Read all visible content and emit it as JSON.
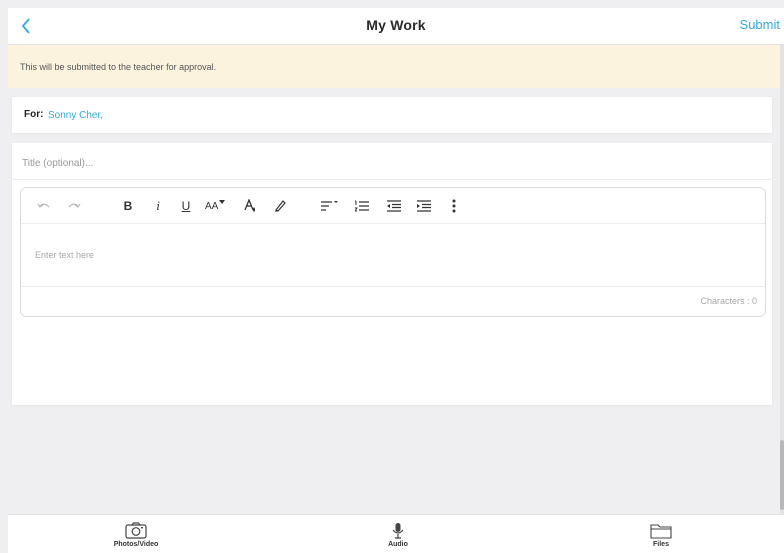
{
  "header": {
    "title": "My Work",
    "submit_label": "Submit",
    "accent_color": "#35a9dd"
  },
  "notice": {
    "text": "This will be submitted to the teacher for approval.",
    "background": "#fbf3de"
  },
  "recipient": {
    "label": "For:",
    "value": "Sonny Cher,"
  },
  "title_field": {
    "placeholder": "Title (optional)..."
  },
  "editor": {
    "placeholder": "Enter text here",
    "characters_label": "Characters : ",
    "characters_count": "0",
    "toolbar": {
      "undo_icon": "undo-icon",
      "redo_icon": "redo-icon",
      "bold": "B",
      "italic": "i",
      "underline": "U",
      "font_size": "AA",
      "text_color_icon": "text-color-icon",
      "highlight_icon": "highlighter-icon",
      "align_icon": "align-left-icon",
      "list_icon": "ordered-list-icon",
      "outdent_icon": "outdent-icon",
      "indent_icon": "indent-icon",
      "more_icon": "more-vertical-icon"
    }
  },
  "bottom_bar": {
    "items": [
      {
        "label": "Photos/Video",
        "icon": "camera-icon"
      },
      {
        "label": "Audio",
        "icon": "microphone-icon"
      },
      {
        "label": "Files",
        "icon": "folder-icon"
      }
    ]
  }
}
